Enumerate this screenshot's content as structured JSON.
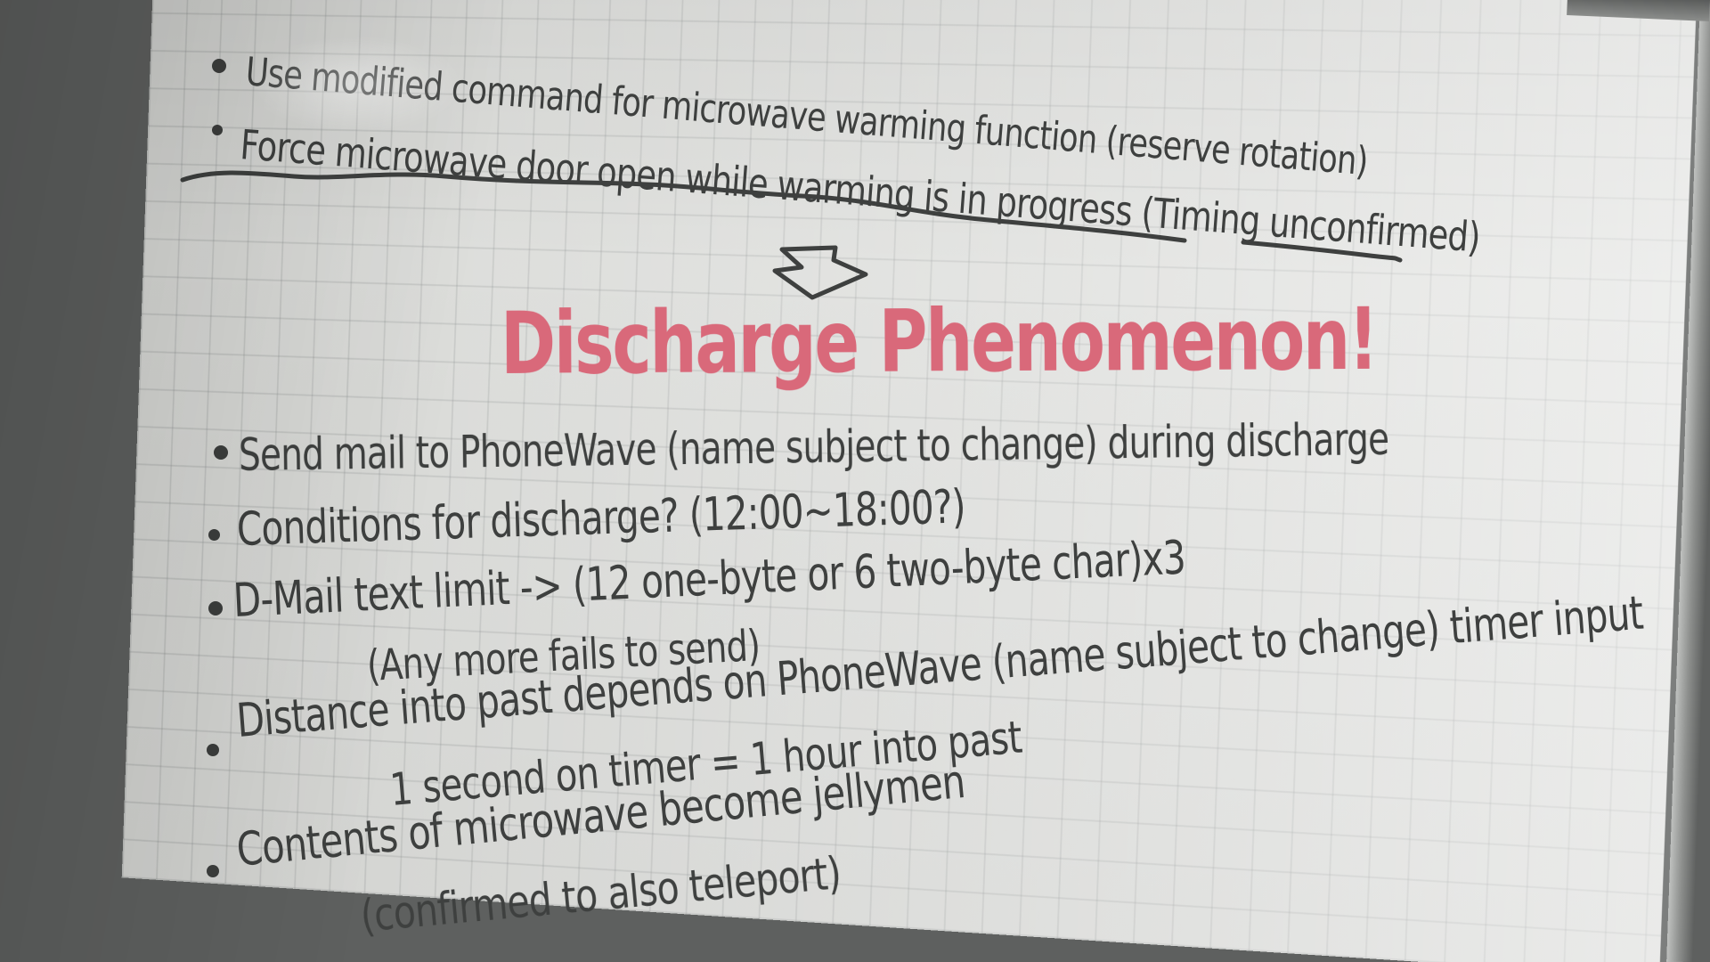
{
  "top": {
    "line1": "Use modified command for microwave warming function (reserve rotation)",
    "line2": "Force microwave door open while warming is in progress (Timing unconfirmed)"
  },
  "headline": "Discharge Phenomenon!",
  "bullets": {
    "b1": "Send mail to PhoneWave (name subject to change) during discharge",
    "b2": "Conditions for discharge? (12:00~18:00?)",
    "b3": "D-Mail text limit -> (12 one-byte or 6 two-byte char)x3",
    "b3_sub": "(Any more fails to send)",
    "b4": "Distance into past depends on PhoneWave (name subject to change) timer input",
    "b4_sub": "1 second on timer = 1 hour into past",
    "b5": "Contents of microwave become jellymen",
    "b5_sub": "(confirmed to also teleport)"
  },
  "colors": {
    "ink": "#3e403f",
    "headline": "#d9697a",
    "board": "#d9dad7"
  }
}
